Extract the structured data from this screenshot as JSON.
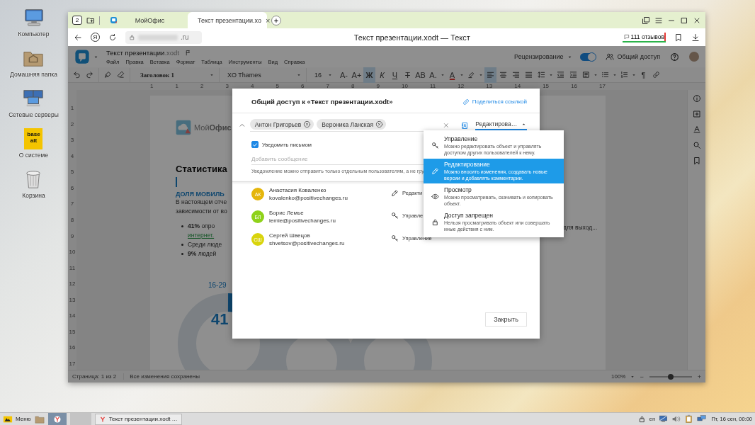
{
  "desktop_icons": [
    {
      "kind": "computer",
      "label": "Компьютер"
    },
    {
      "kind": "home",
      "label": "Домашняя папка"
    },
    {
      "kind": "network",
      "label": "Сетевые серверы"
    },
    {
      "kind": "system",
      "label": "О системе",
      "logo": "base\nalt"
    },
    {
      "kind": "trash",
      "label": "Корзина"
    }
  ],
  "browser": {
    "tab_count": "2",
    "tabs": [
      {
        "label": "МойОфис",
        "selected": false
      },
      {
        "label": "Текст презентации.xo",
        "selected": true,
        "close": "×"
      }
    ],
    "new_tab": "+",
    "home_glyph": "Я",
    "url_tail": ".ru",
    "page_title": "Текст презентации.xodt — Текст",
    "reviews": "111 отзывов"
  },
  "app": {
    "doc_name": "Текст презентации",
    "doc_ext": ".xodt",
    "menu": [
      "Файл",
      "Правка",
      "Вставка",
      "Формат",
      "Таблица",
      "Инструменты",
      "Вид",
      "Справка"
    ],
    "review_mode": "Рецензирование",
    "review_toggle": {
      "on": true
    },
    "share": "Общий доступ"
  },
  "toolbar": [
    {
      "kind": "undo",
      "on": false
    },
    {
      "kind": "redo",
      "on": false
    },
    {
      "kind": "separator"
    },
    {
      "kind": "brush",
      "on": false
    },
    {
      "kind": "eraser",
      "on": false
    },
    {
      "kind": "separator"
    },
    {
      "kind": "select",
      "value": "Заголовок 1"
    },
    {
      "kind": "select",
      "value": "XO Thames"
    },
    {
      "kind": "select",
      "value": "16"
    },
    {
      "kind": "glyph",
      "label": "A-",
      "on": false
    },
    {
      "kind": "glyph",
      "label": "A+",
      "on": false
    },
    {
      "kind": "glyph",
      "label": "Ж",
      "on": true
    },
    {
      "kind": "glyph",
      "label": "К",
      "on": false
    },
    {
      "kind": "glyph",
      "label": "Ч",
      "on": false
    },
    {
      "kind": "glyph",
      "label": "Т",
      "on": false
    },
    {
      "kind": "glyph",
      "label": "АВ",
      "on": false
    },
    {
      "kind": "glyph",
      "label": "А.",
      "on": false
    },
    {
      "kind": "caret"
    },
    {
      "kind": "fontcolor",
      "label": "А",
      "on": false
    },
    {
      "kind": "caret"
    },
    {
      "kind": "highlight",
      "on": false
    },
    {
      "kind": "caret"
    },
    {
      "kind": "align-left",
      "on": true
    },
    {
      "kind": "align-center",
      "on": false
    },
    {
      "kind": "align-right",
      "on": false
    },
    {
      "kind": "justify",
      "on": false
    },
    {
      "kind": "spacing",
      "on": false
    },
    {
      "kind": "caret"
    },
    {
      "kind": "outdent",
      "on": false
    },
    {
      "kind": "indent",
      "on": false
    },
    {
      "kind": "paragraph",
      "on": false
    },
    {
      "kind": "caret"
    },
    {
      "kind": "bullets",
      "on": false
    },
    {
      "kind": "caret"
    },
    {
      "kind": "numbering",
      "on": false
    },
    {
      "kind": "caret"
    },
    {
      "kind": "glyph",
      "label": "¶",
      "on": false
    },
    {
      "kind": "link",
      "on": false
    }
  ],
  "ruler": {
    "horizontal": [
      "1",
      "1",
      "2",
      "3",
      "4",
      "5",
      "6",
      "7",
      "8",
      "9",
      "10",
      "11",
      "12",
      "13",
      "14",
      "15",
      "16",
      "17"
    ],
    "vertical": [
      "1",
      "2",
      "3",
      "4",
      "5",
      "6",
      "7",
      "8",
      "9",
      "10",
      "11",
      "12",
      "13",
      "14",
      "15",
      "16",
      "17"
    ]
  },
  "document": {
    "logo": "Мой**Офис**",
    "heading": "Статистика",
    "subheading": "ДОЛЯ МОБИЛЬ",
    "paragraph": [
      "В настоящем отче",
      "зависимости от во"
    ],
    "bullets": [
      {
        "text": "**41%** опро",
        "link": "интернет."
      },
      {
        "text": "Среди люде"
      },
      {
        "text": "**9%** людей"
      }
    ],
    "right_fragment": "для выход...",
    "chart_caption": "16-29",
    "chart_value": "41"
  },
  "side_tools": [
    {
      "kind": "info"
    },
    {
      "kind": "add"
    },
    {
      "kind": "text"
    },
    {
      "kind": "search"
    },
    {
      "kind": "bookmark"
    }
  ],
  "status_bar": {
    "page": "Страница: 1 из 2",
    "saved": "Все изменения сохранены",
    "zoom": "100%",
    "zoom_minus": "−",
    "zoom_plus": "+",
    "level": 0.5
  },
  "share_dialog": {
    "title": "Общий доступ к «Текст презентации.xodt»",
    "share_link": "Поделиться ссылкой",
    "recipients": [
      "Антон Григорьев",
      "Вероника Ланская"
    ],
    "access": {
      "value": "Редактирова…",
      "expanded": true
    },
    "notify": {
      "label": "Уведомить письмом",
      "checked": true
    },
    "message": {
      "placeholder": "Добавить сообщение"
    },
    "hint": "Уведомление можно отправить только отдельным пользователям, а не гру",
    "users": [
      {
        "initials": "АК",
        "color": "#e5b60b",
        "name": "Анастасия Коваленко",
        "email": "kovalenko@positivechanges.ru",
        "kind": "edit",
        "role": "Редакти"
      },
      {
        "initials": "БЛ",
        "color": "#8fd21a",
        "name": "Борис Лемье",
        "email": "lemie@positivechanges.ru",
        "kind": "manage",
        "role": "Управле"
      },
      {
        "initials": "СШ",
        "color": "#d9d40c",
        "name": "Сергей Швецов",
        "email": "shvetsov@positivechanges.ru",
        "kind": "manage",
        "role": "Управление"
      }
    ],
    "close": "Закрыть",
    "access_menu": [
      {
        "kind": "manage",
        "title": "Управление",
        "description": "Можно редактировать объект и управлять доступом других пользователей к нему.",
        "selected": false
      },
      {
        "kind": "edit",
        "title": "Редактирование",
        "description": "Можно вносить изменения, создавать новые версии и добавлять комментарии.",
        "selected": true
      },
      {
        "kind": "view",
        "title": "Просмотр",
        "description": "Можно просматривать, скачивать и копировать объект.",
        "selected": false
      },
      {
        "kind": "deny",
        "title": "Доступ запрещен",
        "description": "Нельзя просматривать объект или совершать иные действия с ним.",
        "selected": false
      }
    ]
  },
  "taskbar": {
    "menu": "Меню",
    "task": "Текст презентации.xodt …",
    "lang": "en",
    "clock": "Пт, 16 сен, 00:00"
  }
}
